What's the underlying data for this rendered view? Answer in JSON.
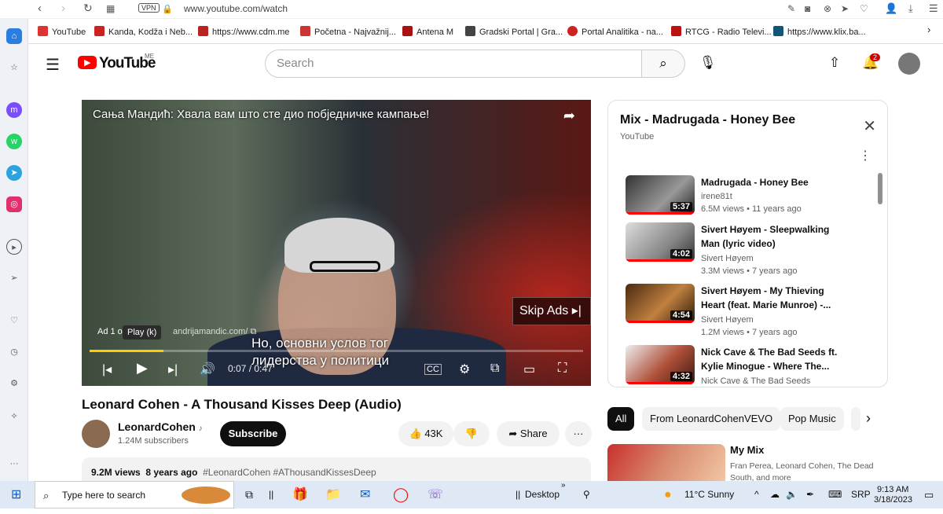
{
  "browser": {
    "url": "www.youtube.com/watch",
    "vpn": "VPN",
    "bookmarks": [
      {
        "label": "YouTube",
        "color": "#222"
      },
      {
        "label": "Kanda, Kodža i Neb...",
        "color": "#c22"
      },
      {
        "label": "https://www.cdm.me",
        "color": "#b22"
      },
      {
        "label": "Početna - Najvažnij...",
        "color": "#c33"
      },
      {
        "label": "Antena M",
        "color": "#a11"
      },
      {
        "label": "Gradski Portal | Gra...",
        "color": "#444"
      },
      {
        "label": "Portal Analitika - na...",
        "color": "#c22"
      },
      {
        "label": "RTCG - Radio Televi...",
        "color": "#b11"
      },
      {
        "label": "https://www.klix.ba...",
        "color": "#157"
      }
    ]
  },
  "youtube": {
    "logo": "YouTube",
    "region": "ME",
    "search_placeholder": "Search",
    "notifications": "2"
  },
  "video": {
    "overlay_title": "Сања Мандић: Хвала вам што сте дио побједничке кампање!",
    "skip_label": "Skip Ads",
    "ad_text": "Ad 1 o",
    "tooltip": "Play (k)",
    "ad_link": "andrijamandic.com/",
    "subtitle": "Но, основни услов тог лидерства у политици",
    "time": "0:07 / 0:47",
    "progress_fraction": 0.15,
    "title": "Leonard Cohen - A Thousand Kisses Deep (Audio)",
    "channel": "LeonardCohen",
    "subscribers": "1.24M subscribers",
    "subscribe": "Subscribe",
    "likes": "43K",
    "share": "Share",
    "views": "9.2M views",
    "age": "8 years ago",
    "hashtags": "#LeonardCohen #AThousandKissesDeep"
  },
  "playlist": {
    "title": "Mix - Madrugada - Honey Bee",
    "subtitle": "YouTube",
    "items": [
      {
        "title1": "Madrugada - Honey Bee",
        "title2": "",
        "channel": "irene81t",
        "meta": "6.5M views • 11 years ago",
        "duration": "5:37",
        "thumb": "#555"
      },
      {
        "title1": "Sivert Høyem - Sleepwalking",
        "title2": "Man (lyric video)",
        "channel": "Sivert Høyem",
        "meta": "3.3M views • 7 years ago",
        "duration": "4:02",
        "thumb": "#777"
      },
      {
        "title1": "Sivert Høyem - My Thieving",
        "title2": "Heart (feat. Marie Munroe) -...",
        "channel": "Sivert Høyem",
        "meta": "1.2M views • 7 years ago",
        "duration": "4:54",
        "thumb": "#6a4a2a"
      },
      {
        "title1": "Nick Cave & The Bad Seeds ft.",
        "title2": "Kylie Minogue - Where The...",
        "channel": "Nick Cave & The Bad Seeds",
        "meta": "",
        "duration": "4:32",
        "thumb": "#8a3a2a"
      }
    ]
  },
  "chips": [
    "All",
    "From LeonardCohenVEVO",
    "Pop Music"
  ],
  "mix": {
    "title": "My Mix",
    "line1": "Fran Perea, Leonard Cohen, The Dead",
    "line2": "South, and more"
  },
  "taskbar": {
    "search": "Type here to search",
    "desktop": "Desktop",
    "weather": "11°C  Sunny",
    "lang": "SRP",
    "time": "9:13 AM",
    "date": "3/18/2023"
  }
}
